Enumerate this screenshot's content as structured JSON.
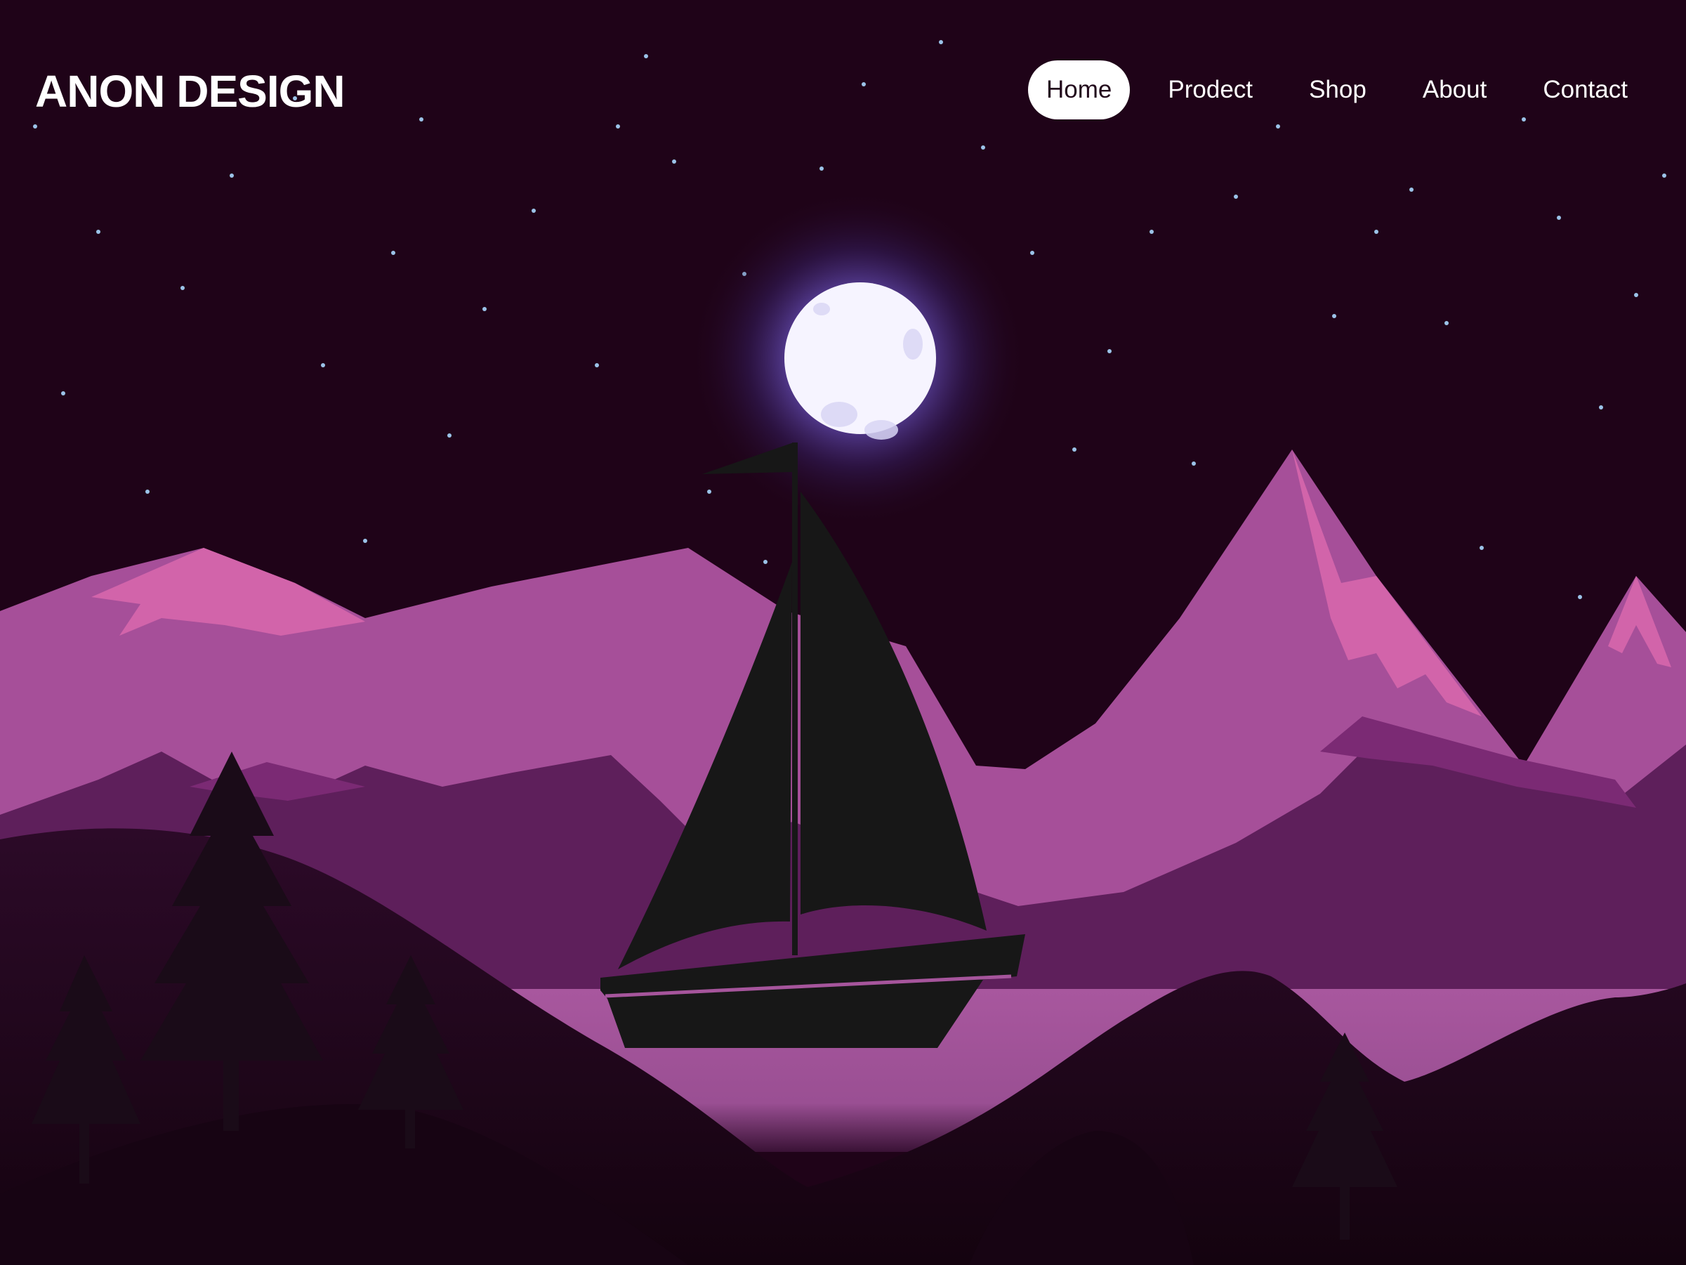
{
  "header": {
    "brand": "ANON DESIGN",
    "nav": [
      {
        "label": "Home",
        "active": true
      },
      {
        "label": "Prodect",
        "active": false
      },
      {
        "label": "Shop",
        "active": false
      },
      {
        "label": "About",
        "active": false
      },
      {
        "label": "Contact",
        "active": false
      }
    ]
  },
  "hero": {
    "illustration": "night-landscape-sailboat-moon",
    "colors": {
      "sky": "#1f0318",
      "mountain_far": "#a64f99",
      "mountain_peak": "#d264aa",
      "mountain_mid": "#5e1f5b",
      "lake": "#a6559c",
      "hills_dark": "#2e0b2a",
      "silhouette": "#171717",
      "moon": "#f4f2ff",
      "moon_glow": "#6e58d8"
    }
  }
}
